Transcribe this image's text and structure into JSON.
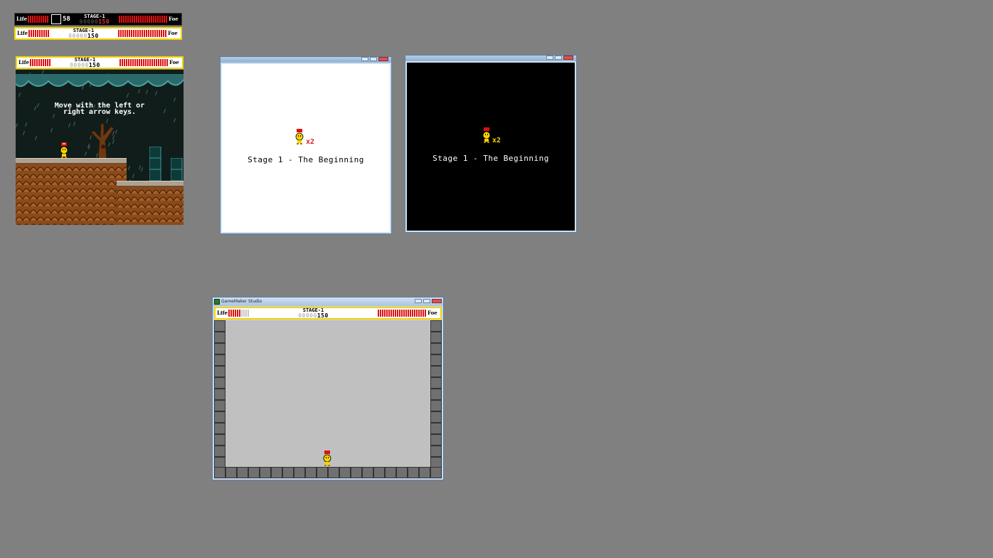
{
  "hud": {
    "life_label": "Life",
    "foe_label": "Foe",
    "stage_label": "STAGE-1",
    "score_dim": "00000",
    "score_value": "150",
    "item_count": "58"
  },
  "scene1": {
    "tutorial_line1": "Move with the left or",
    "tutorial_line2": "right arrow keys."
  },
  "intro_white": {
    "lives_text": "x2",
    "stage_text": "Stage 1 - The Beginning",
    "accent": "#e02020"
  },
  "intro_black": {
    "lives_text": "x2",
    "stage_text": "Stage 1 - The Beginning",
    "accent": "#f2d400"
  },
  "editor": {
    "window_title": "GameMaker Studio"
  },
  "colors": {
    "background": "#808080",
    "life_red": "#e01010",
    "hud_border_yellow": "#f2d400"
  }
}
